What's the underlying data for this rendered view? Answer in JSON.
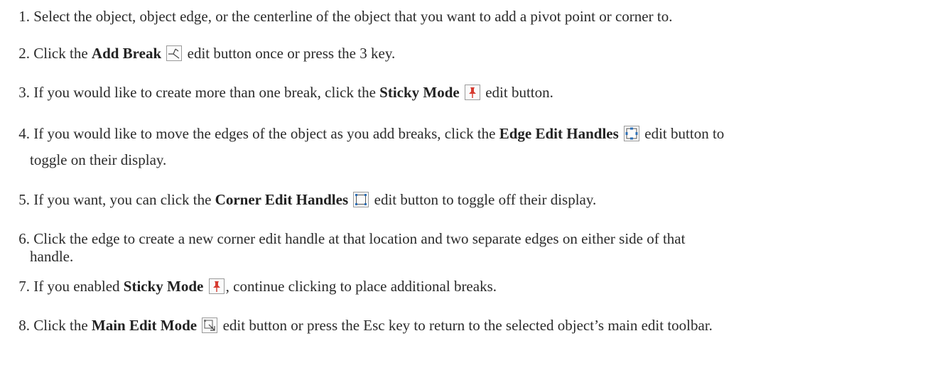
{
  "steps": [
    {
      "num": "1.",
      "text": "Select the object, object edge, or the centerline of the object that you want to add a pivot point or corner to."
    },
    {
      "num": "2.",
      "pre": "Click the ",
      "bold": "Add Break",
      "post": " edit button once or press the 3 key.",
      "icon": "add-break-icon"
    },
    {
      "num": "3.",
      "pre": "If you would like to create more than one break, click the ",
      "bold": "Sticky Mode",
      "post": " edit button.",
      "icon": "sticky-mode-pushpin-icon"
    },
    {
      "num": "4.",
      "pre": "If you would like to move the edges of the object as you add breaks, click the ",
      "bold": "Edge Edit Handles",
      "post": " edit button to",
      "cont": "toggle on their display.",
      "icon": "edge-edit-handles-icon"
    },
    {
      "num": "5.",
      "pre": "If you want, you can click the ",
      "bold": "Corner Edit Handles",
      "post": " edit button to toggle off their display.",
      "icon": "corner-edit-handles-icon"
    },
    {
      "num": "6.",
      "text": "Click the edge to create a new corner edit handle at that location and two separate edges on either side of that",
      "cont": "handle."
    },
    {
      "num": "7.",
      "pre": "If you enabled ",
      "bold": "Sticky Mode",
      "post": ", continue clicking to place additional breaks.",
      "icon": "sticky-mode-pushpin-icon"
    },
    {
      "num": "8.",
      "pre": "Click the ",
      "bold": "Main Edit Mode",
      "post": " edit button or press the Esc key to return to the selected object’s main edit toolbar.",
      "icon": "main-edit-mode-icon"
    }
  ],
  "colors": {
    "text": "#2b2b2b",
    "pin_red": "#d63a2f",
    "handle_blue": "#2d6fb6"
  }
}
